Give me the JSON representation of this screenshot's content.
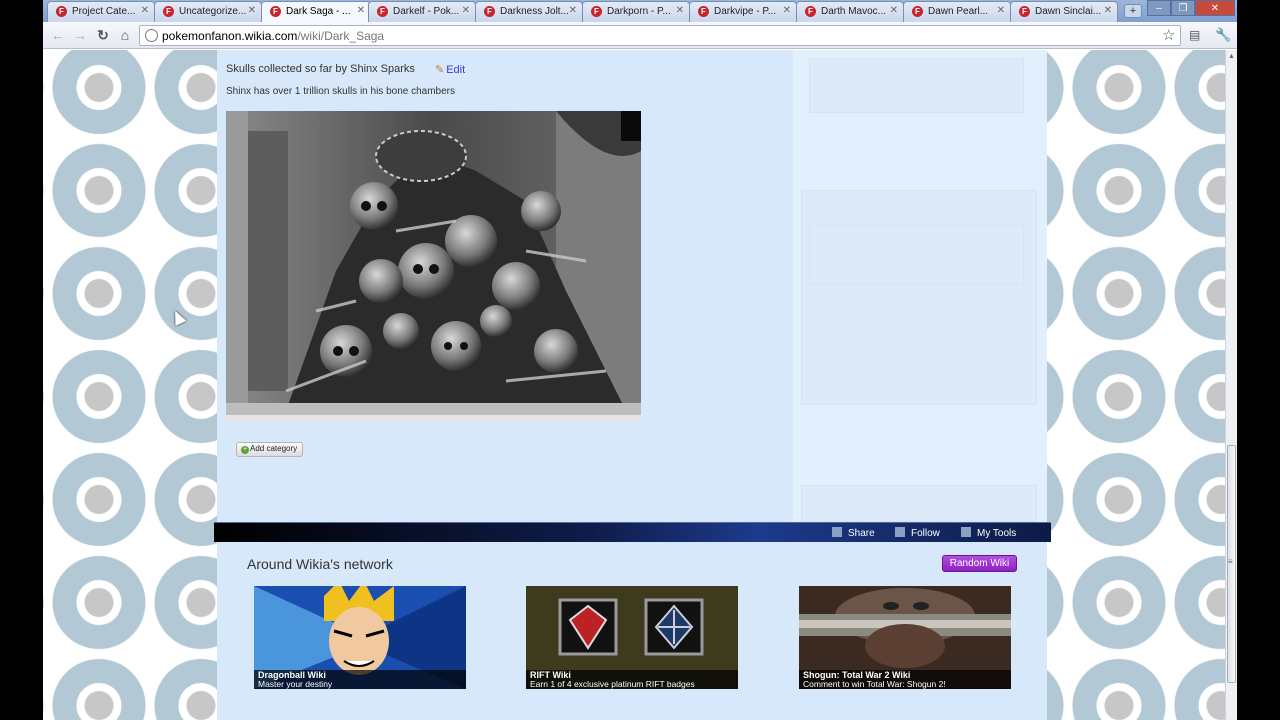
{
  "browser": {
    "tabs": [
      {
        "title": "Project Cate..."
      },
      {
        "title": "Uncategorize..."
      },
      {
        "title": "Dark Saga - ..."
      },
      {
        "title": "Darkelf - Pok..."
      },
      {
        "title": "Darkness Jolt..."
      },
      {
        "title": "Darkporn - P..."
      },
      {
        "title": "Darkvipe - P..."
      },
      {
        "title": "Darth Mavoc..."
      },
      {
        "title": "Dawn Pearl..."
      },
      {
        "title": "Dawn Sinclai..."
      }
    ],
    "new_tab": "+",
    "address_host": "pokemonfanon.wikia.com",
    "address_path": "/wiki/Dark_Saga"
  },
  "article": {
    "heading": "Skulls collected so far by Shinx Sparks",
    "edit_label": "Edit",
    "description": "Shinx has over 1 trillion skulls in his bone chambers",
    "add_category_label": "Add category"
  },
  "wikia_bar": {
    "share": "Share",
    "follow": "Follow",
    "my_tools": "My Tools"
  },
  "network": {
    "title": "Around Wikia's network",
    "random_wiki": "Random Wiki",
    "promos": [
      {
        "title": "Dragonball Wiki",
        "subtitle": "Master your destiny"
      },
      {
        "title": "RIFT Wiki",
        "subtitle": "Earn 1 of 4 exclusive platinum RIFT badges"
      },
      {
        "title": "Shogun: Total War 2 Wiki",
        "subtitle": "Comment to win Total War: Shogun 2!"
      }
    ]
  },
  "icons": {
    "back": "back-arrow-icon",
    "forward": "forward-arrow-icon",
    "reload": "reload-icon",
    "home": "home-icon",
    "star": "bookmark-star-icon",
    "page": "page-menu-icon",
    "wrench": "wrench-icon",
    "favicon": "wikia-favicon-icon",
    "share": "share-icon",
    "follow": "follow-icon",
    "tools": "tools-icon"
  }
}
